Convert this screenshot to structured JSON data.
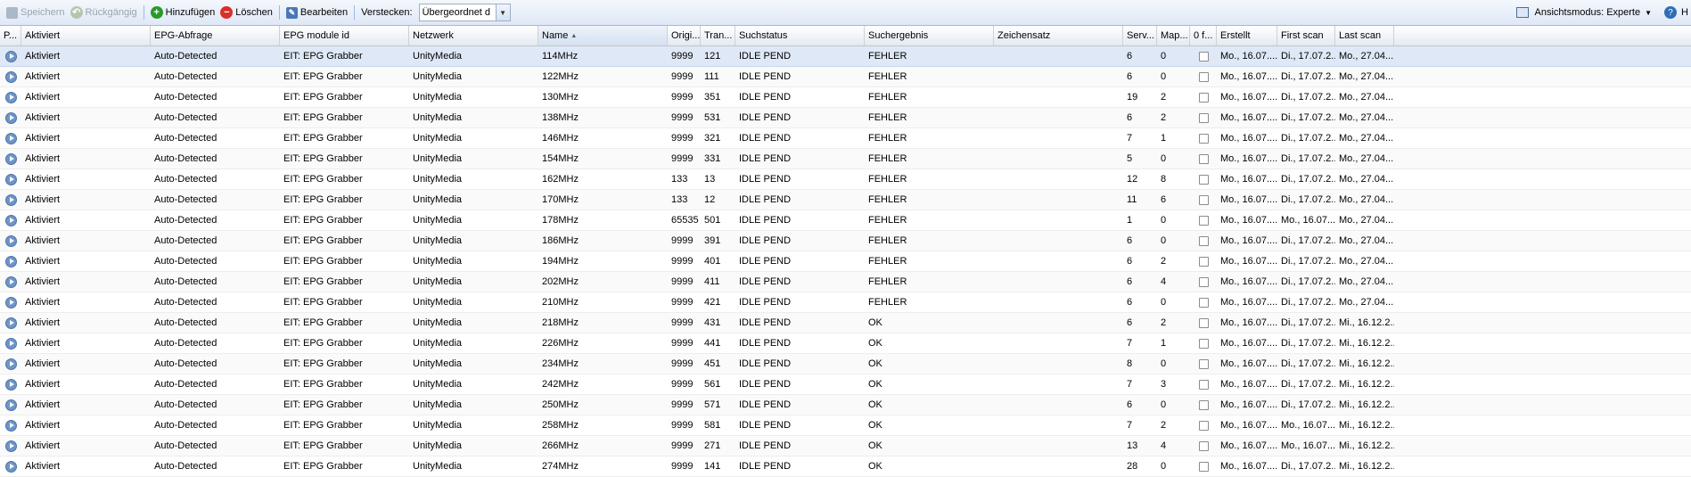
{
  "toolbar": {
    "save_label": "Speichern",
    "undo_label": "Rückgängig",
    "add_label": "Hinzufügen",
    "delete_label": "Löschen",
    "edit_label": "Bearbeiten",
    "hide_label": "Verstecken:",
    "hide_value": "Übergeordnet d",
    "view_mode_label": "Ansichtsmodus: Experte",
    "help_label": "H"
  },
  "columns": [
    "P...",
    "Aktiviert",
    "EPG-Abfrage",
    "EPG module id",
    "Netzwerk",
    "Name",
    "Origi...",
    "Tran...",
    "Suchstatus",
    "Suchergebnis",
    "Zeichensatz",
    "Serv...",
    "Map...",
    "0 f...",
    "Erstellt",
    "First scan",
    "Last scan"
  ],
  "sorted_column": "Name",
  "rows": [
    {
      "enabled": "Aktiviert",
      "epg": "Auto-Detected",
      "module": "EIT: EPG Grabber",
      "network": "UnityMedia",
      "name": "114MHz",
      "onid": "9999",
      "tsid": "121",
      "status": "IDLE PEND",
      "result": "FEHLER",
      "charset": "",
      "services": "6",
      "mapped": "0",
      "created": "Mo., 16.07....",
      "first": "Di., 17.07.2...",
      "last": "Mo., 27.04...."
    },
    {
      "enabled": "Aktiviert",
      "epg": "Auto-Detected",
      "module": "EIT: EPG Grabber",
      "network": "UnityMedia",
      "name": "122MHz",
      "onid": "9999",
      "tsid": "111",
      "status": "IDLE PEND",
      "result": "FEHLER",
      "charset": "",
      "services": "6",
      "mapped": "0",
      "created": "Mo., 16.07....",
      "first": "Di., 17.07.2...",
      "last": "Mo., 27.04...."
    },
    {
      "enabled": "Aktiviert",
      "epg": "Auto-Detected",
      "module": "EIT: EPG Grabber",
      "network": "UnityMedia",
      "name": "130MHz",
      "onid": "9999",
      "tsid": "351",
      "status": "IDLE PEND",
      "result": "FEHLER",
      "charset": "",
      "services": "19",
      "mapped": "2",
      "created": "Mo., 16.07....",
      "first": "Di., 17.07.2...",
      "last": "Mo., 27.04...."
    },
    {
      "enabled": "Aktiviert",
      "epg": "Auto-Detected",
      "module": "EIT: EPG Grabber",
      "network": "UnityMedia",
      "name": "138MHz",
      "onid": "9999",
      "tsid": "531",
      "status": "IDLE PEND",
      "result": "FEHLER",
      "charset": "",
      "services": "6",
      "mapped": "2",
      "created": "Mo., 16.07....",
      "first": "Di., 17.07.2...",
      "last": "Mo., 27.04...."
    },
    {
      "enabled": "Aktiviert",
      "epg": "Auto-Detected",
      "module": "EIT: EPG Grabber",
      "network": "UnityMedia",
      "name": "146MHz",
      "onid": "9999",
      "tsid": "321",
      "status": "IDLE PEND",
      "result": "FEHLER",
      "charset": "",
      "services": "7",
      "mapped": "1",
      "created": "Mo., 16.07....",
      "first": "Di., 17.07.2...",
      "last": "Mo., 27.04...."
    },
    {
      "enabled": "Aktiviert",
      "epg": "Auto-Detected",
      "module": "EIT: EPG Grabber",
      "network": "UnityMedia",
      "name": "154MHz",
      "onid": "9999",
      "tsid": "331",
      "status": "IDLE PEND",
      "result": "FEHLER",
      "charset": "",
      "services": "5",
      "mapped": "0",
      "created": "Mo., 16.07....",
      "first": "Di., 17.07.2...",
      "last": "Mo., 27.04...."
    },
    {
      "enabled": "Aktiviert",
      "epg": "Auto-Detected",
      "module": "EIT: EPG Grabber",
      "network": "UnityMedia",
      "name": "162MHz",
      "onid": "133",
      "tsid": "13",
      "status": "IDLE PEND",
      "result": "FEHLER",
      "charset": "",
      "services": "12",
      "mapped": "8",
      "created": "Mo., 16.07....",
      "first": "Di., 17.07.2...",
      "last": "Mo., 27.04...."
    },
    {
      "enabled": "Aktiviert",
      "epg": "Auto-Detected",
      "module": "EIT: EPG Grabber",
      "network": "UnityMedia",
      "name": "170MHz",
      "onid": "133",
      "tsid": "12",
      "status": "IDLE PEND",
      "result": "FEHLER",
      "charset": "",
      "services": "11",
      "mapped": "6",
      "created": "Mo., 16.07....",
      "first": "Di., 17.07.2...",
      "last": "Mo., 27.04...."
    },
    {
      "enabled": "Aktiviert",
      "epg": "Auto-Detected",
      "module": "EIT: EPG Grabber",
      "network": "UnityMedia",
      "name": "178MHz",
      "onid": "65535",
      "tsid": "501",
      "status": "IDLE PEND",
      "result": "FEHLER",
      "charset": "",
      "services": "1",
      "mapped": "0",
      "created": "Mo., 16.07....",
      "first": "Mo., 16.07....",
      "last": "Mo., 27.04...."
    },
    {
      "enabled": "Aktiviert",
      "epg": "Auto-Detected",
      "module": "EIT: EPG Grabber",
      "network": "UnityMedia",
      "name": "186MHz",
      "onid": "9999",
      "tsid": "391",
      "status": "IDLE PEND",
      "result": "FEHLER",
      "charset": "",
      "services": "6",
      "mapped": "0",
      "created": "Mo., 16.07....",
      "first": "Di., 17.07.2...",
      "last": "Mo., 27.04...."
    },
    {
      "enabled": "Aktiviert",
      "epg": "Auto-Detected",
      "module": "EIT: EPG Grabber",
      "network": "UnityMedia",
      "name": "194MHz",
      "onid": "9999",
      "tsid": "401",
      "status": "IDLE PEND",
      "result": "FEHLER",
      "charset": "",
      "services": "6",
      "mapped": "2",
      "created": "Mo., 16.07....",
      "first": "Di., 17.07.2...",
      "last": "Mo., 27.04...."
    },
    {
      "enabled": "Aktiviert",
      "epg": "Auto-Detected",
      "module": "EIT: EPG Grabber",
      "network": "UnityMedia",
      "name": "202MHz",
      "onid": "9999",
      "tsid": "411",
      "status": "IDLE PEND",
      "result": "FEHLER",
      "charset": "",
      "services": "6",
      "mapped": "4",
      "created": "Mo., 16.07....",
      "first": "Di., 17.07.2...",
      "last": "Mo., 27.04...."
    },
    {
      "enabled": "Aktiviert",
      "epg": "Auto-Detected",
      "module": "EIT: EPG Grabber",
      "network": "UnityMedia",
      "name": "210MHz",
      "onid": "9999",
      "tsid": "421",
      "status": "IDLE PEND",
      "result": "FEHLER",
      "charset": "",
      "services": "6",
      "mapped": "0",
      "created": "Mo., 16.07....",
      "first": "Di., 17.07.2...",
      "last": "Mo., 27.04...."
    },
    {
      "enabled": "Aktiviert",
      "epg": "Auto-Detected",
      "module": "EIT: EPG Grabber",
      "network": "UnityMedia",
      "name": "218MHz",
      "onid": "9999",
      "tsid": "431",
      "status": "IDLE PEND",
      "result": "OK",
      "charset": "",
      "services": "6",
      "mapped": "2",
      "created": "Mo., 16.07....",
      "first": "Di., 17.07.2...",
      "last": "Mi., 16.12.2..."
    },
    {
      "enabled": "Aktiviert",
      "epg": "Auto-Detected",
      "module": "EIT: EPG Grabber",
      "network": "UnityMedia",
      "name": "226MHz",
      "onid": "9999",
      "tsid": "441",
      "status": "IDLE PEND",
      "result": "OK",
      "charset": "",
      "services": "7",
      "mapped": "1",
      "created": "Mo., 16.07....",
      "first": "Di., 17.07.2...",
      "last": "Mi., 16.12.2..."
    },
    {
      "enabled": "Aktiviert",
      "epg": "Auto-Detected",
      "module": "EIT: EPG Grabber",
      "network": "UnityMedia",
      "name": "234MHz",
      "onid": "9999",
      "tsid": "451",
      "status": "IDLE PEND",
      "result": "OK",
      "charset": "",
      "services": "8",
      "mapped": "0",
      "created": "Mo., 16.07....",
      "first": "Di., 17.07.2...",
      "last": "Mi., 16.12.2..."
    },
    {
      "enabled": "Aktiviert",
      "epg": "Auto-Detected",
      "module": "EIT: EPG Grabber",
      "network": "UnityMedia",
      "name": "242MHz",
      "onid": "9999",
      "tsid": "561",
      "status": "IDLE PEND",
      "result": "OK",
      "charset": "",
      "services": "7",
      "mapped": "3",
      "created": "Mo., 16.07....",
      "first": "Di., 17.07.2...",
      "last": "Mi., 16.12.2..."
    },
    {
      "enabled": "Aktiviert",
      "epg": "Auto-Detected",
      "module": "EIT: EPG Grabber",
      "network": "UnityMedia",
      "name": "250MHz",
      "onid": "9999",
      "tsid": "571",
      "status": "IDLE PEND",
      "result": "OK",
      "charset": "",
      "services": "6",
      "mapped": "0",
      "created": "Mo., 16.07....",
      "first": "Di., 17.07.2...",
      "last": "Mi., 16.12.2..."
    },
    {
      "enabled": "Aktiviert",
      "epg": "Auto-Detected",
      "module": "EIT: EPG Grabber",
      "network": "UnityMedia",
      "name": "258MHz",
      "onid": "9999",
      "tsid": "581",
      "status": "IDLE PEND",
      "result": "OK",
      "charset": "",
      "services": "7",
      "mapped": "2",
      "created": "Mo., 16.07....",
      "first": "Mo., 16.07....",
      "last": "Mi., 16.12.2..."
    },
    {
      "enabled": "Aktiviert",
      "epg": "Auto-Detected",
      "module": "EIT: EPG Grabber",
      "network": "UnityMedia",
      "name": "266MHz",
      "onid": "9999",
      "tsid": "271",
      "status": "IDLE PEND",
      "result": "OK",
      "charset": "",
      "services": "13",
      "mapped": "4",
      "created": "Mo., 16.07....",
      "first": "Mo., 16.07....",
      "last": "Mi., 16.12.2..."
    },
    {
      "enabled": "Aktiviert",
      "epg": "Auto-Detected",
      "module": "EIT: EPG Grabber",
      "network": "UnityMedia",
      "name": "274MHz",
      "onid": "9999",
      "tsid": "141",
      "status": "IDLE PEND",
      "result": "OK",
      "charset": "",
      "services": "28",
      "mapped": "0",
      "created": "Mo., 16.07....",
      "first": "Di., 17.07.2...",
      "last": "Mi., 16.12.2..."
    }
  ]
}
